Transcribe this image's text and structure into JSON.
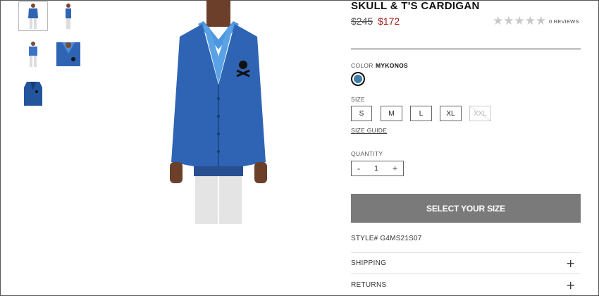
{
  "product": {
    "title": "SKULL & T'S CARDIGAN",
    "original_price": "$245",
    "sale_price": "$172",
    "rating_stars": 0,
    "reviews_label": "0 REVIEWS",
    "style_label": "STYLE# G4MS21S07"
  },
  "color": {
    "label": "COLOR",
    "name": "MYKONOS",
    "swatch_hex": "#3d7fa8"
  },
  "size": {
    "label": "SIZE",
    "options": [
      "S",
      "M",
      "L",
      "XL",
      "XXL"
    ],
    "unavailable": [
      "XXL"
    ],
    "guide_label": "SIZE GUIDE"
  },
  "quantity": {
    "label": "QUANTITY",
    "value": "1",
    "minus": "-",
    "plus": "+"
  },
  "cta": {
    "label": "SELECT YOUR SIZE"
  },
  "accordion": [
    {
      "label": "SHIPPING",
      "icon": "plus-icon"
    },
    {
      "label": "RETURNS",
      "icon": "plus-icon"
    }
  ],
  "thumbnails": [
    "front-full-view",
    "side-full-view",
    "front-untucked-view",
    "detail-closeup-view",
    "flat-lay-view"
  ],
  "colors": {
    "sweater": "#2f64b4",
    "sale_price": "#a31a1a",
    "cta_bg": "#7a7a7a"
  }
}
